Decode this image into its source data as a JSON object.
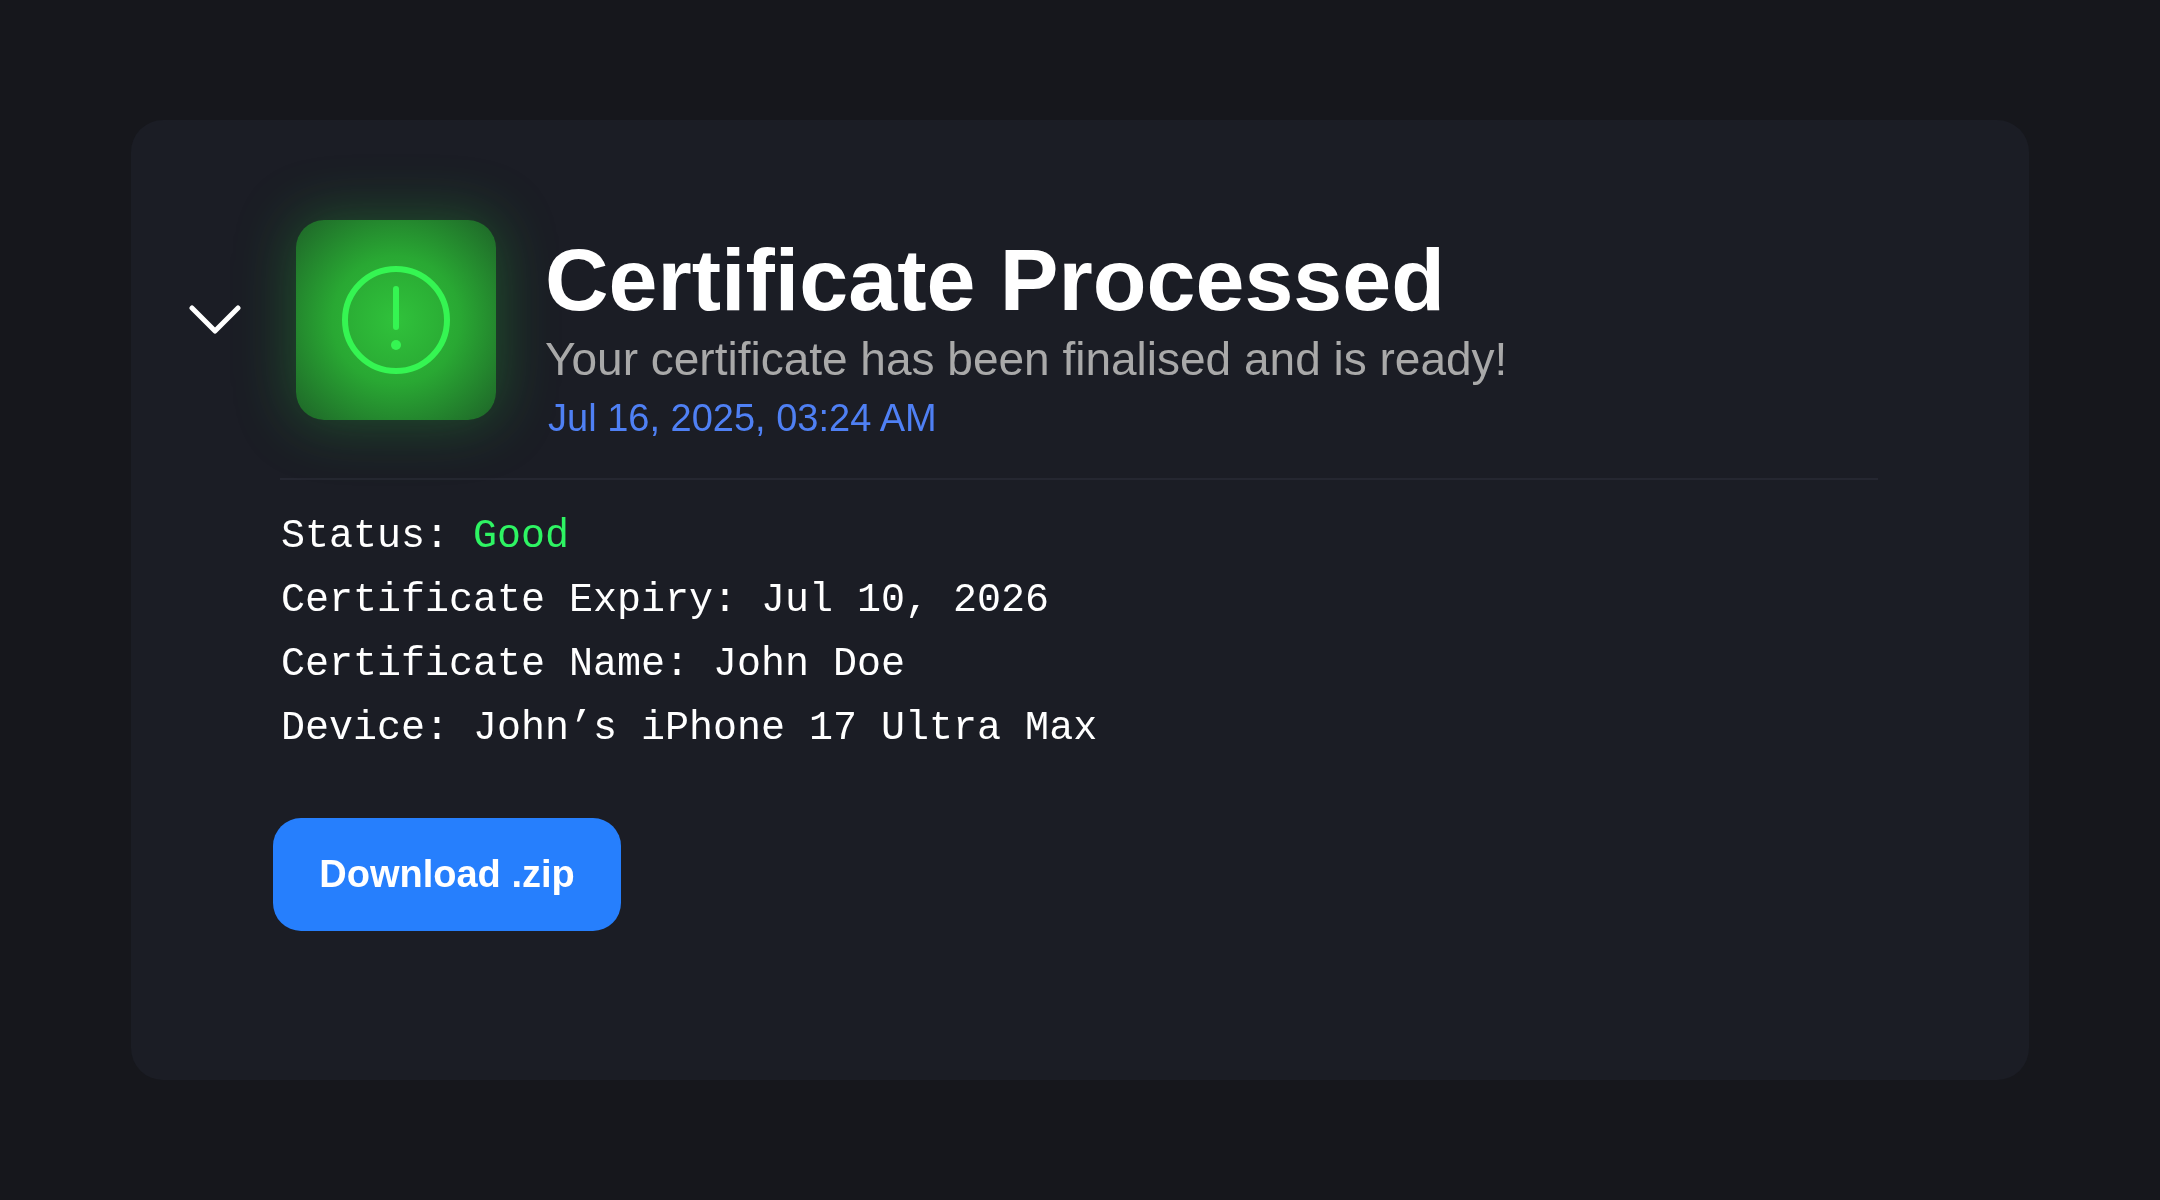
{
  "notification": {
    "expanded": true,
    "title": "Certificate Processed",
    "message": "Your certificate has been finalised and is ready!",
    "timestamp": "Jul 16, 2025, 03:24 AM",
    "details": [
      {
        "kind": "status",
        "label": "Status:",
        "value": "Good"
      },
      {
        "kind": "text",
        "label": "Certificate Expiry:",
        "value": "Jul 10, 2026"
      },
      {
        "kind": "text",
        "label": "Certificate Name:",
        "value": "John Doe"
      },
      {
        "kind": "text",
        "label": "Device:",
        "value": "John’s iPhone 17 Ultra Max"
      }
    ],
    "button": "Download .zip"
  }
}
